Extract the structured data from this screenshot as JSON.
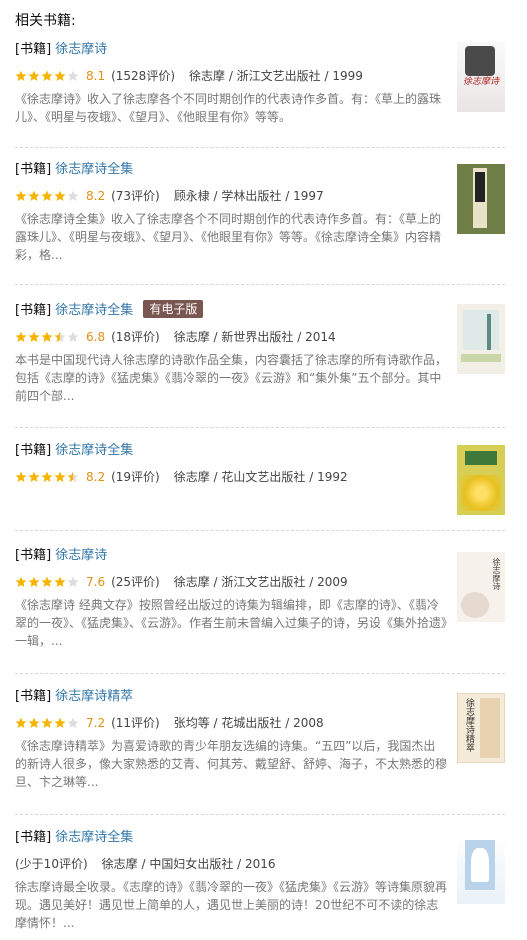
{
  "section_title": "相关书籍:",
  "colors": {
    "link": "#3377aa",
    "rating": "#e09015",
    "star": "#f5b400",
    "badge_bg": "#7a5651"
  },
  "books": [
    {
      "category": "[书籍]",
      "title": "徐志摩诗",
      "rating": "8.1",
      "stars": 4,
      "count": "(1528评价)",
      "pub": "徐志摩 / 浙江文艺出版社 / 1999",
      "desc": "《徐志摩诗》收入了徐志摩各个不同时期创作的代表诗作多首。有：《草上的露珠儿》、《明星与夜蛾》、《望月》、《他眼里有你》等等。",
      "cover_text": "徐志摩诗",
      "cover_style": "1"
    },
    {
      "category": "[书籍]",
      "title": "徐志摩诗全集",
      "rating": "8.2",
      "stars": 4,
      "count": "(73评价)",
      "pub": "顾永棣 / 学林出版社 / 1997",
      "desc": "《徐志摩诗全集》收入了徐志摩各个不同时期创作的代表诗作多首。有：《草上的露珠儿》、《明星与夜蛾》、《望月》、《他眼里有你》等等。《徐志摩诗全集》内容精彩，格...",
      "cover_text": "",
      "cover_style": "2"
    },
    {
      "category": "[书籍]",
      "title": "徐志摩诗全集",
      "badge": "有电子版",
      "rating": "6.8",
      "stars": 3.5,
      "count": "(18评价)",
      "pub": "徐志摩 / 新世界出版社 / 2014",
      "desc": "本书是中国现代诗人徐志摩的诗歌作品全集，内容囊括了徐志摩的所有诗歌作品，包括《志摩的诗》《猛虎集》《翡冷翠的一夜》《云游》和“集外集”五个部分。其中前四个部...",
      "cover_text": "",
      "cover_style": "3"
    },
    {
      "category": "[书籍]",
      "title": "徐志摩诗全集",
      "rating": "8.2",
      "stars": 4.5,
      "count": "(19评价)",
      "pub": "徐志摩 / 花山文艺出版社 / 1992",
      "desc": "",
      "cover_text": "",
      "cover_style": "4"
    },
    {
      "category": "[书籍]",
      "title": "徐志摩诗",
      "rating": "7.6",
      "stars": 4,
      "count": "(25评价)",
      "pub": "徐志摩 / 浙江文艺出版社 / 2009",
      "desc": "《徐志摩诗 经典文存》按照曾经出版过的诗集为辑编排，即《志摩的诗》、《翡冷翠的一夜》、《猛虎集》、《云游》。作者生前未曾编入过集子的诗，另设《集外拾遗》一辑，...",
      "cover_text": "徐志摩诗",
      "cover_style": "5"
    },
    {
      "category": "[书籍]",
      "title": "徐志摩诗精萃",
      "rating": "7.2",
      "stars": 4,
      "count": "(11评价)",
      "pub": "张均等 / 花城出版社 / 2008",
      "desc": "《徐志摩诗精萃》为喜爱诗歌的青少年朋友选编的诗集。“五四”以后，我国杰出的新诗人很多，像大家熟悉的艾青、何其芳、戴望舒、舒婷、海子，不太熟悉的穆旦、卞之琳等...",
      "cover_text": "徐志摩诗精萃",
      "cover_style": "6"
    },
    {
      "category": "[书籍]",
      "title": "徐志摩诗全集",
      "count": "(少于10评价)",
      "pub": "徐志摩 / 中国妇女出版社 / 2016",
      "desc": "徐志摩诗最全收录。《志摩的诗》《翡冷翠的一夜》《猛虎集》《云游》等诗集原貌再现。遇见美好！遇见世上简单的人，遇见世上美丽的诗！20世纪不可不读的徐志摩情怀！...",
      "cover_text": "",
      "cover_style": "7"
    }
  ]
}
